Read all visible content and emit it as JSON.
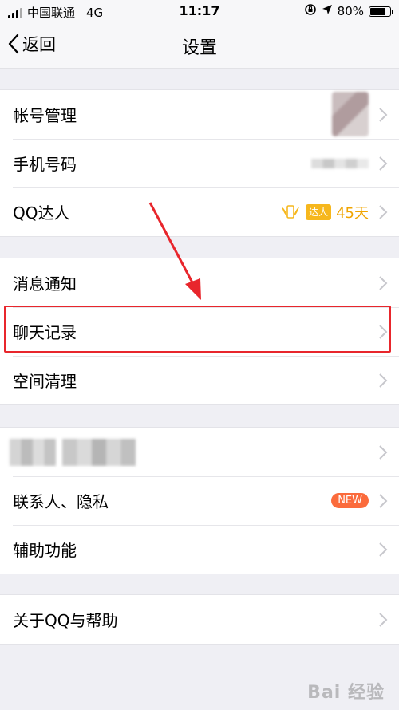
{
  "status_bar": {
    "carrier": "中国联通",
    "network": "4G",
    "time": "11:17",
    "battery": "80%"
  },
  "navbar": {
    "back_label": "返回",
    "title": "设置"
  },
  "sections": [
    {
      "items": [
        {
          "label": "帐号管理"
        },
        {
          "label": "手机号码"
        },
        {
          "label": "QQ达人",
          "badge": "达人",
          "days": "45天"
        }
      ]
    },
    {
      "items": [
        {
          "label": "消息通知"
        },
        {
          "label": "聊天记录"
        },
        {
          "label": "空间清理"
        }
      ]
    },
    {
      "items": [
        {
          "label": ""
        },
        {
          "label": "联系人、隐私",
          "badge": "NEW"
        },
        {
          "label": "辅助功能"
        }
      ]
    },
    {
      "items": [
        {
          "label": "关于QQ与帮助"
        }
      ]
    }
  ],
  "colors": {
    "highlight": "#e8262c",
    "new_badge": "#fb6b3c",
    "qq_badge": "#f6b71d"
  },
  "watermark": "Bai 经验"
}
